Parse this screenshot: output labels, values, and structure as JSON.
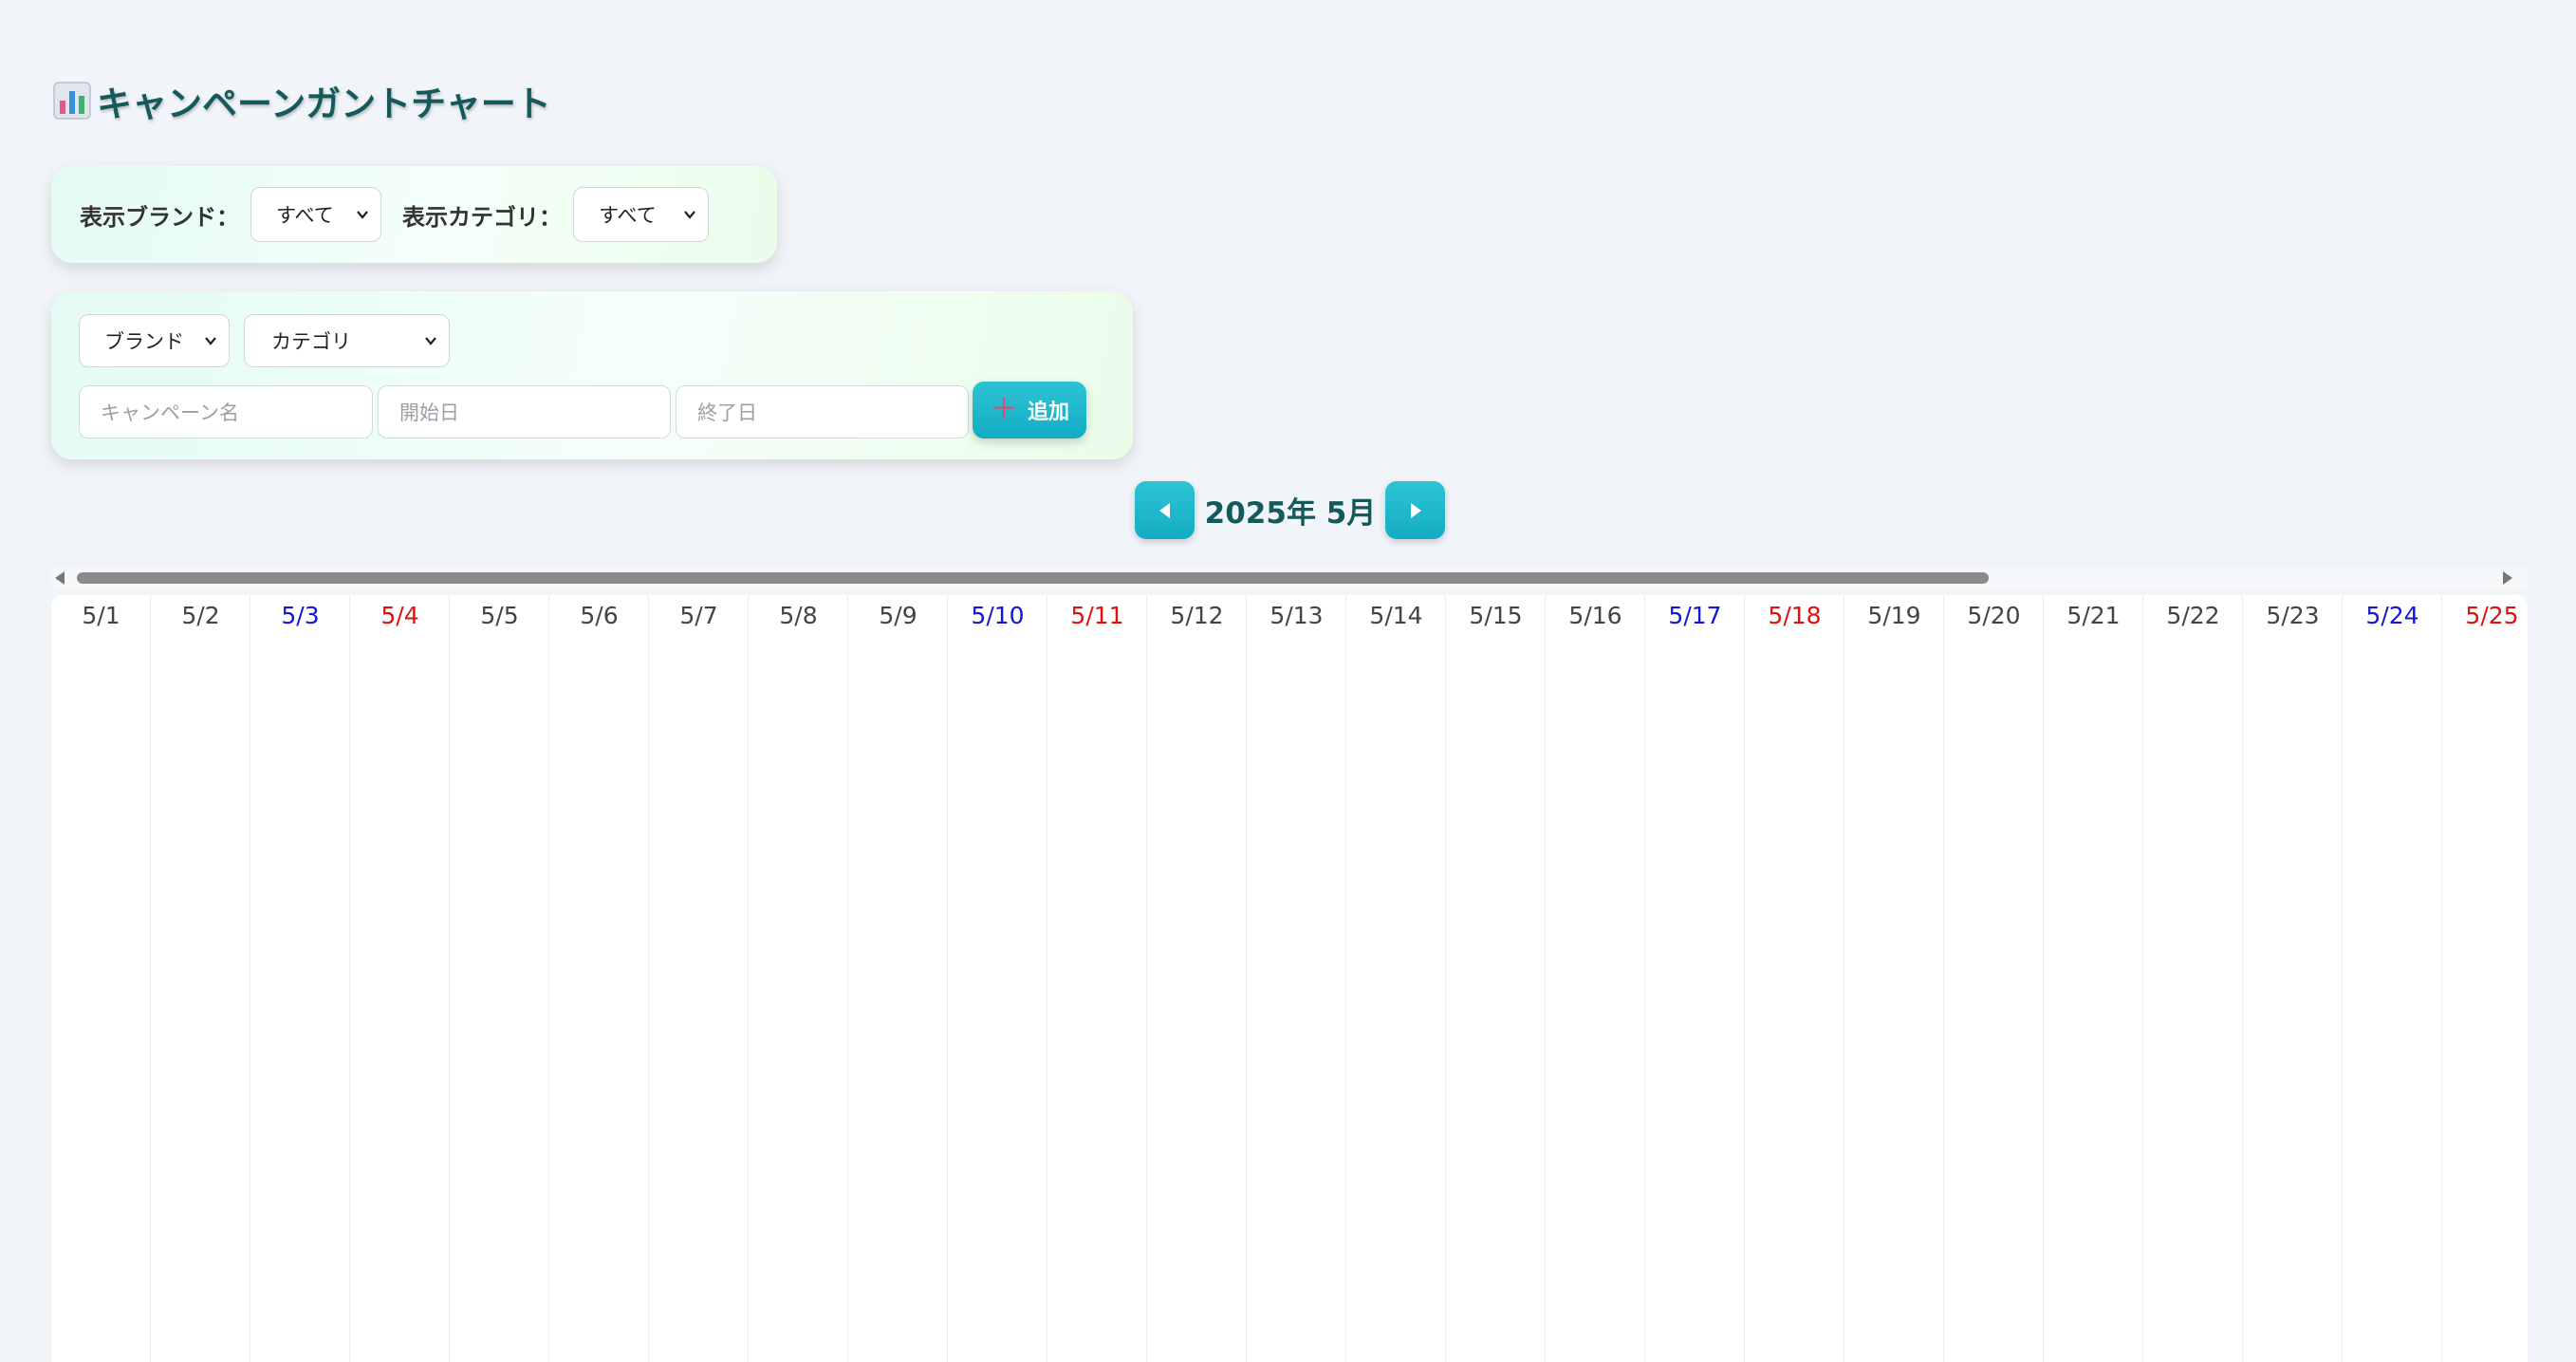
{
  "title": "キャンペーンガントチャート",
  "title_icon": "bar-chart-icon",
  "filters": {
    "brand_label": "表示ブランド：",
    "brand_value": "すべて",
    "category_label": "表示カテゴリ：",
    "category_value": "すべて"
  },
  "form": {
    "brand_select": "ブランド",
    "category_select": "カテゴリ",
    "campaign_placeholder": "キャンペーン名",
    "start_placeholder": "開始日",
    "end_placeholder": "終了日",
    "add_label": "追加",
    "add_icon": "plus-icon"
  },
  "nav": {
    "month_label": "2025年 5月",
    "prev_icon": "triangle-left-icon",
    "next_icon": "triangle-right-icon"
  },
  "colors": {
    "accent": "#1db5c9",
    "title": "#14595b",
    "saturday": "#1515d6",
    "sunday": "#e01010"
  },
  "days": [
    {
      "label": "5/1",
      "type": "weekday"
    },
    {
      "label": "5/2",
      "type": "weekday"
    },
    {
      "label": "5/3",
      "type": "sat"
    },
    {
      "label": "5/4",
      "type": "sun"
    },
    {
      "label": "5/5",
      "type": "weekday"
    },
    {
      "label": "5/6",
      "type": "weekday"
    },
    {
      "label": "5/7",
      "type": "weekday"
    },
    {
      "label": "5/8",
      "type": "weekday"
    },
    {
      "label": "5/9",
      "type": "weekday"
    },
    {
      "label": "5/10",
      "type": "sat"
    },
    {
      "label": "5/11",
      "type": "sun"
    },
    {
      "label": "5/12",
      "type": "weekday"
    },
    {
      "label": "5/13",
      "type": "weekday"
    },
    {
      "label": "5/14",
      "type": "weekday"
    },
    {
      "label": "5/15",
      "type": "weekday"
    },
    {
      "label": "5/16",
      "type": "weekday"
    },
    {
      "label": "5/17",
      "type": "sat"
    },
    {
      "label": "5/18",
      "type": "sun"
    },
    {
      "label": "5/19",
      "type": "weekday"
    },
    {
      "label": "5/20",
      "type": "weekday"
    },
    {
      "label": "5/21",
      "type": "weekday"
    },
    {
      "label": "5/22",
      "type": "weekday"
    },
    {
      "label": "5/23",
      "type": "weekday"
    },
    {
      "label": "5/24",
      "type": "sat"
    },
    {
      "label": "5/25",
      "type": "sun"
    }
  ]
}
